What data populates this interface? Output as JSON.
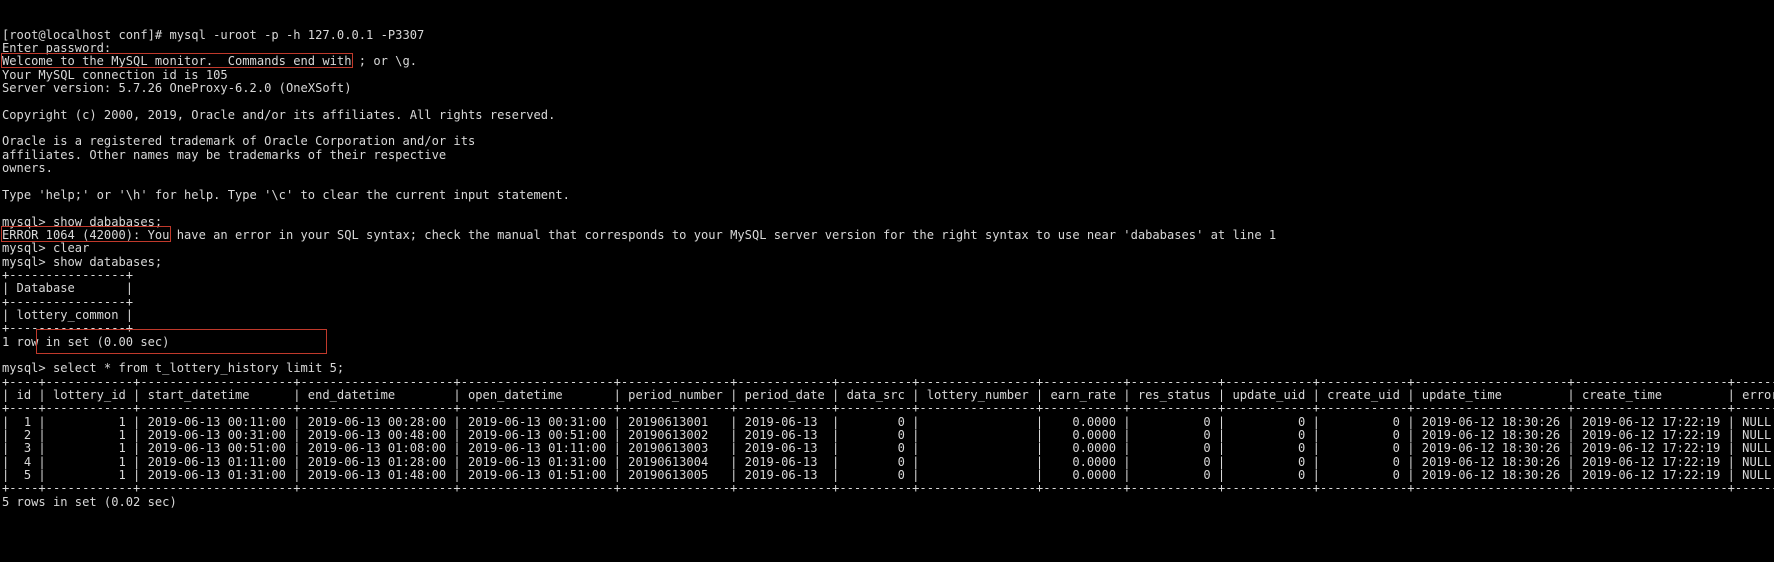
{
  "terminal": {
    "app": "mysql-client-terminal",
    "colors": {
      "background": "#000000",
      "foreground": "#d8d8d8",
      "annotation": "#c0392b"
    },
    "lines": [
      "[root@localhost conf]# mysql -uroot -p -h 127.0.0.1 -P3307",
      "Enter password:",
      "Welcome to the MySQL monitor.  Commands end with ; or \\g.",
      "Your MySQL connection id is 105",
      "Server version: 5.7.26 OneProxy-6.2.0 (OneXSoft)",
      "",
      "Copyright (c) 2000, 2019, Oracle and/or its affiliates. All rights reserved.",
      "",
      "Oracle is a registered trademark of Oracle Corporation and/or its",
      "affiliates. Other names may be trademarks of their respective",
      "owners.",
      "",
      "Type 'help;' or '\\h' for help. Type '\\c' to clear the current input statement.",
      "",
      "mysql> show dababases;",
      "ERROR 1064 (42000): You have an error in your SQL syntax; check the manual that corresponds to your MySQL server version for the right syntax to use near 'dababases' at line 1",
      "mysql> clear",
      "mysql> show databases;",
      "+----------------+",
      "| Database       |",
      "+----------------+",
      "| lottery_common |",
      "+----------------+",
      "1 row in set (0.00 sec)",
      "",
      "mysql> select * from t_lottery_history limit 5;",
      "+----+------------+---------------------+---------------------+---------------------+---------------+-------------+----------+----------------+-----------+------------+------------+------------+---------------------+---------------------+-----------+",
      "| id | lottery_id | start_datetime      | end_datetime        | open_datetime       | period_number | period_date | data_src | lottery_number | earn_rate | res_status | update_uid | create_uid | update_time         | create_time         | error_msg |",
      "+----+------------+---------------------+---------------------+---------------------+---------------+-------------+----------+----------------+-----------+------------+------------+------------+---------------------+---------------------+-----------+",
      "|  1 |          1 | 2019-06-13 00:11:00 | 2019-06-13 00:28:00 | 2019-06-13 00:31:00 | 20190613001   | 2019-06-13  |        0 |                |    0.0000 |          0 |          0 |          0 | 2019-06-12 18:30:26 | 2019-06-12 17:22:19 | NULL      |",
      "|  2 |          1 | 2019-06-13 00:31:00 | 2019-06-13 00:48:00 | 2019-06-13 00:51:00 | 20190613002   | 2019-06-13  |        0 |                |    0.0000 |          0 |          0 |          0 | 2019-06-12 18:30:26 | 2019-06-12 17:22:19 | NULL      |",
      "|  3 |          1 | 2019-06-13 00:51:00 | 2019-06-13 01:08:00 | 2019-06-13 01:11:00 | 20190613003   | 2019-06-13  |        0 |                |    0.0000 |          0 |          0 |          0 | 2019-06-12 18:30:26 | 2019-06-12 17:22:19 | NULL      |",
      "|  4 |          1 | 2019-06-13 01:11:00 | 2019-06-13 01:28:00 | 2019-06-13 01:31:00 | 20190613004   | 2019-06-13  |        0 |                |    0.0000 |          0 |          0 |          0 | 2019-06-12 18:30:26 | 2019-06-12 17:22:19 | NULL      |",
      "|  5 |          1 | 2019-06-13 01:31:00 | 2019-06-13 01:48:00 | 2019-06-13 01:51:00 | 20190613005   | 2019-06-13  |        0 |                |    0.0000 |          0 |          0 |          0 | 2019-06-12 18:30:26 | 2019-06-12 17:22:19 | NULL      |",
      "+----+------------+---------------------+---------------------+---------------------+---------------+-------------+----------+----------------+-----------+------------+------------+------------+---------------------+---------------------+-----------+",
      "5 rows in set (0.02 sec)"
    ],
    "annotations": [
      {
        "name": "server-version-highlight",
        "target": "Server version: 5.7.26 OneProxy-6.2.0 (OneXSoft)"
      },
      {
        "name": "show-databases-highlight",
        "target": "mysql> show databases;"
      },
      {
        "name": "select-query-highlight",
        "target": "select * from t_lottery_history limit 5;"
      }
    ],
    "session": {
      "prompt": "mysql>",
      "shell_prompt": "[root@localhost conf]#",
      "connect_command": "mysql -uroot -p -h 127.0.0.1 -P3307",
      "host": "127.0.0.1",
      "port": "3307",
      "user": "root",
      "connection_id": "105",
      "server_version": "5.7.26 OneProxy-6.2.0 (OneXSoft)"
    }
  },
  "databases_result": {
    "columns": [
      "Database"
    ],
    "rows": [
      [
        "lottery_common"
      ]
    ],
    "status": "1 row in set (0.00 sec)"
  },
  "history_result": {
    "query": "select * from t_lottery_history limit 5;",
    "columns": [
      "id",
      "lottery_id",
      "start_datetime",
      "end_datetime",
      "open_datetime",
      "period_number",
      "period_date",
      "data_src",
      "lottery_number",
      "earn_rate",
      "res_status",
      "update_uid",
      "create_uid",
      "update_time",
      "create_time",
      "error_msg"
    ],
    "rows": [
      [
        "1",
        "1",
        "2019-06-13 00:11:00",
        "2019-06-13 00:28:00",
        "2019-06-13 00:31:00",
        "20190613001",
        "2019-06-13",
        "0",
        "",
        "0.0000",
        "0",
        "0",
        "0",
        "2019-06-12 18:30:26",
        "2019-06-12 17:22:19",
        "NULL"
      ],
      [
        "2",
        "1",
        "2019-06-13 00:31:00",
        "2019-06-13 00:48:00",
        "2019-06-13 00:51:00",
        "20190613002",
        "2019-06-13",
        "0",
        "",
        "0.0000",
        "0",
        "0",
        "0",
        "2019-06-12 18:30:26",
        "2019-06-12 17:22:19",
        "NULL"
      ],
      [
        "3",
        "1",
        "2019-06-13 00:51:00",
        "2019-06-13 01:08:00",
        "2019-06-13 01:11:00",
        "20190613003",
        "2019-06-13",
        "0",
        "",
        "0.0000",
        "0",
        "0",
        "0",
        "2019-06-12 18:30:26",
        "2019-06-12 17:22:19",
        "NULL"
      ],
      [
        "4",
        "1",
        "2019-06-13 01:11:00",
        "2019-06-13 01:28:00",
        "2019-06-13 01:31:00",
        "20190613004",
        "2019-06-13",
        "0",
        "",
        "0.0000",
        "0",
        "0",
        "0",
        "2019-06-12 18:30:26",
        "2019-06-12 17:22:19",
        "NULL"
      ],
      [
        "5",
        "1",
        "2019-06-13 01:31:00",
        "2019-06-13 01:48:00",
        "2019-06-13 01:51:00",
        "20190613005",
        "2019-06-13",
        "0",
        "",
        "0.0000",
        "0",
        "0",
        "0",
        "2019-06-12 18:30:26",
        "2019-06-12 17:22:19",
        "NULL"
      ]
    ],
    "status": "5 rows in set (0.02 sec)"
  },
  "error": {
    "code": "ERROR 1064 (42000)",
    "message": "You have an error in your SQL syntax; check the manual that corresponds to your MySQL server version for the right syntax to use near 'dababases' at line 1",
    "bad_statement": "show dababases;"
  }
}
